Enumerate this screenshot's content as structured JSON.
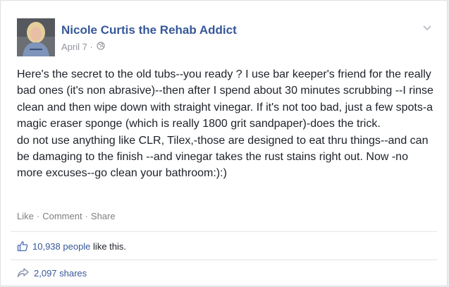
{
  "post": {
    "author": "Nicole Curtis the Rehab Addict",
    "date": "April 7",
    "dot": "·",
    "paragraph1": "Here's the secret to the old tubs--you ready ? I use bar keeper's friend for the really bad ones (it's non abrasive)--then after I spend about 30 minutes scrubbing --I rinse clean and then wipe down with straight vinegar. If it's not too bad, just a few spots-a magic eraser sponge (which is really 1800 grit sandpaper)-does the trick.",
    "paragraph2": "do not use anything like CLR, Tilex,-those are designed to eat thru things--and can be damaging to the finish --and vinegar takes the rust stains right out. Now -no more excuses--go clean your bathroom:):)"
  },
  "actions": {
    "like": "Like",
    "comment": "Comment",
    "share": "Share",
    "separator": "·"
  },
  "likes": {
    "count_people": "10,938 people",
    "suffix": "like this."
  },
  "shares": {
    "label": "2,097 shares"
  },
  "icons": {
    "privacy": "globe-icon",
    "menu": "chevron-down-icon",
    "like": "thumbs-up-icon",
    "share": "share-arrow-icon"
  },
  "colors": {
    "link": "#365899",
    "text": "#1d2129",
    "muted": "#90949c"
  }
}
